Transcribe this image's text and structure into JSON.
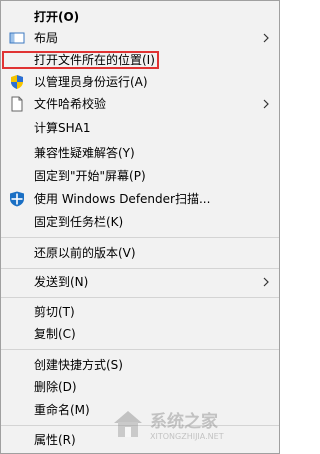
{
  "menu": {
    "items": [
      {
        "label": "打开(O)"
      },
      {
        "label": "布局"
      },
      {
        "label": "打开文件所在的位置(I)"
      },
      {
        "label": "以管理员身份运行(A)"
      },
      {
        "label": "文件哈希校验"
      },
      {
        "label": "计算SHA1"
      },
      {
        "label": "兼容性疑难解答(Y)"
      },
      {
        "label": "固定到\"开始\"屏幕(P)"
      },
      {
        "label": "使用 Windows Defender扫描..."
      },
      {
        "label": "固定到任务栏(K)"
      },
      {
        "label": "还原以前的版本(V)"
      },
      {
        "label": "发送到(N)"
      },
      {
        "label": "剪切(T)"
      },
      {
        "label": "复制(C)"
      },
      {
        "label": "创建快捷方式(S)"
      },
      {
        "label": "删除(D)"
      },
      {
        "label": "重命名(M)"
      },
      {
        "label": "属性(R)"
      }
    ]
  },
  "watermark": {
    "text": "系统之家",
    "subtext": "XITONGZHIJIA.NET"
  },
  "colors": {
    "highlight_border": "#e03333",
    "menu_bg": "#f2f2f2",
    "separator": "#d4d4d4",
    "shield_blue": "#1a6fc4"
  }
}
